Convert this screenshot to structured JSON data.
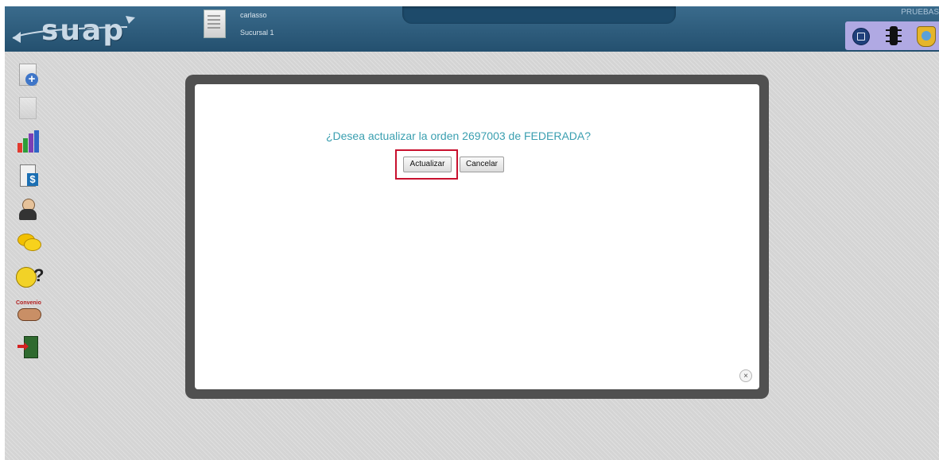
{
  "header": {
    "logo_text": "suap",
    "user": "carlasso",
    "branch": "Sucursal 1",
    "environment": "PRUEBAS"
  },
  "toolbar": {
    "icons": [
      "window-icon",
      "traffic-light-icon",
      "shield-icon"
    ]
  },
  "sidebar": {
    "items": [
      {
        "icon": "new-document-icon"
      },
      {
        "icon": "document-icon"
      },
      {
        "icon": "bar-chart-icon"
      },
      {
        "icon": "invoice-icon"
      },
      {
        "icon": "doctor-icon"
      },
      {
        "icon": "chat-bubbles-icon"
      },
      {
        "icon": "help-icon"
      },
      {
        "icon": "handshake-icon",
        "label": "Convenio"
      },
      {
        "icon": "exit-door-icon"
      }
    ]
  },
  "dialog": {
    "question": "¿Desea actualizar la orden 2697003 de FEDERADA?",
    "confirm_label": "Actualizar",
    "cancel_label": "Cancelar",
    "close_symbol": "×"
  },
  "colors": {
    "header": "#2e5d7e",
    "question_text": "#3a9fb0",
    "highlight": "#c8102e",
    "toolbar_bg": "#b0a9e3"
  }
}
